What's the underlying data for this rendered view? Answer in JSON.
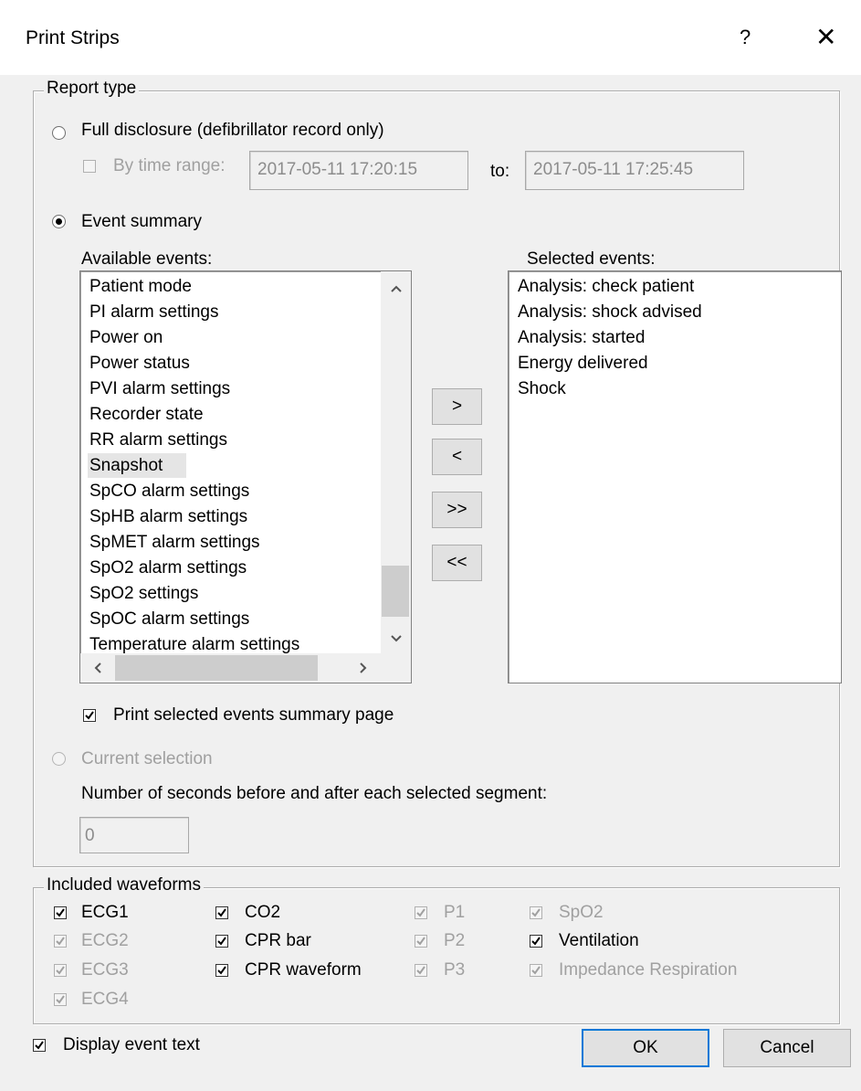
{
  "dialog": {
    "title": "Print Strips",
    "help": "?",
    "close": "✕"
  },
  "report_type": {
    "legend": "Report type",
    "full_disclosure": {
      "label": "Full disclosure (defibrillator record only)",
      "selected": false
    },
    "by_time_range": {
      "label": "By time range:",
      "checked": false,
      "enabled": false,
      "from": "2017-05-11 17:20:15",
      "to_label": "to:",
      "to": "2017-05-11 17:25:45"
    },
    "event_summary": {
      "label": "Event summary",
      "selected": true
    },
    "available_label": "Available events:",
    "selected_label": "Selected events:",
    "available_events": [
      "Patient mode",
      "PI alarm settings",
      "Power on",
      "Power status",
      "PVI alarm settings",
      "Recorder state",
      "RR alarm settings",
      "Snapshot",
      "SpCO alarm settings",
      "SpHB alarm settings",
      "SpMET alarm settings",
      "SpO2 alarm settings",
      "SpO2 settings",
      "SpOC alarm settings",
      "Temperature alarm settings"
    ],
    "selected_events": [
      "Analysis: check patient",
      "Analysis: shock advised",
      "Analysis: started",
      "Energy delivered",
      "Shock"
    ],
    "move_buttons": {
      "add": ">",
      "remove": "<",
      "add_all": ">>",
      "remove_all": "<<"
    },
    "print_summary": {
      "label": "Print selected events summary page",
      "checked": true
    },
    "current_selection": {
      "label": "Current selection",
      "selected": false,
      "enabled": false
    },
    "seconds_label": "Number of seconds before and after each selected segment:",
    "seconds_value": "0"
  },
  "waveforms": {
    "legend": "Included waveforms",
    "items": {
      "ecg1": {
        "label": "ECG1",
        "checked": true,
        "enabled": true
      },
      "ecg2": {
        "label": "ECG2",
        "checked": true,
        "enabled": false
      },
      "ecg3": {
        "label": "ECG3",
        "checked": true,
        "enabled": false
      },
      "ecg4": {
        "label": "ECG4",
        "checked": true,
        "enabled": false
      },
      "co2": {
        "label": "CO2",
        "checked": true,
        "enabled": true
      },
      "cpr_bar": {
        "label": "CPR bar",
        "checked": true,
        "enabled": true
      },
      "cpr_waveform": {
        "label": "CPR waveform",
        "checked": true,
        "enabled": true
      },
      "p1": {
        "label": "P1",
        "checked": true,
        "enabled": false
      },
      "p2": {
        "label": "P2",
        "checked": true,
        "enabled": false
      },
      "p3": {
        "label": "P3",
        "checked": true,
        "enabled": false
      },
      "spo2": {
        "label": "SpO2",
        "checked": true,
        "enabled": false
      },
      "ventilation": {
        "label": "Ventilation",
        "checked": true,
        "enabled": true
      },
      "impedance": {
        "label": "Impedance Respiration",
        "checked": true,
        "enabled": false
      }
    }
  },
  "display_event_text": {
    "label": "Display event text",
    "checked": true
  },
  "buttons": {
    "ok": "OK",
    "cancel": "Cancel"
  }
}
